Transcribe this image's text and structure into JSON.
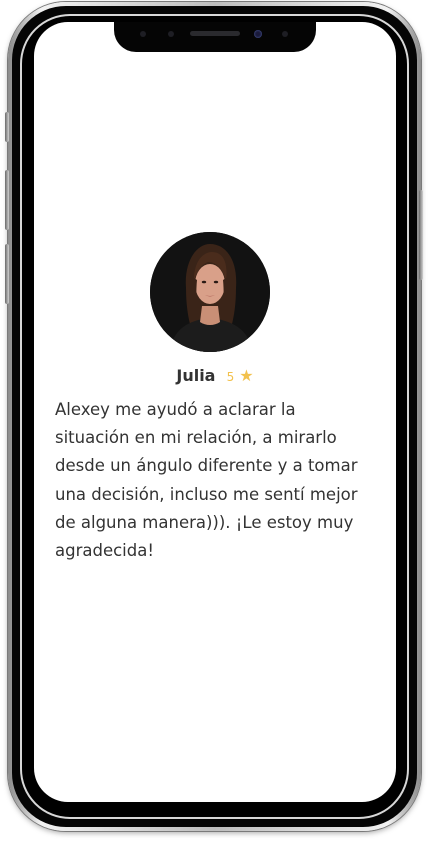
{
  "review": {
    "reviewer_name": "Julia",
    "rating_value": "5",
    "star_icon": "★",
    "text": "Alexey me ayudó a aclarar la situación en mi relación, a mirarlo desde un ángulo diferente y a tomar una decisión, incluso me sentí mejor de alguna manera))). ¡Le estoy muy agradecida!"
  },
  "colors": {
    "star": "#f2c14e",
    "text": "#333333",
    "avatar_background": "#121212"
  },
  "icons": {
    "rating": "star-icon",
    "avatar": "person-portrait"
  }
}
